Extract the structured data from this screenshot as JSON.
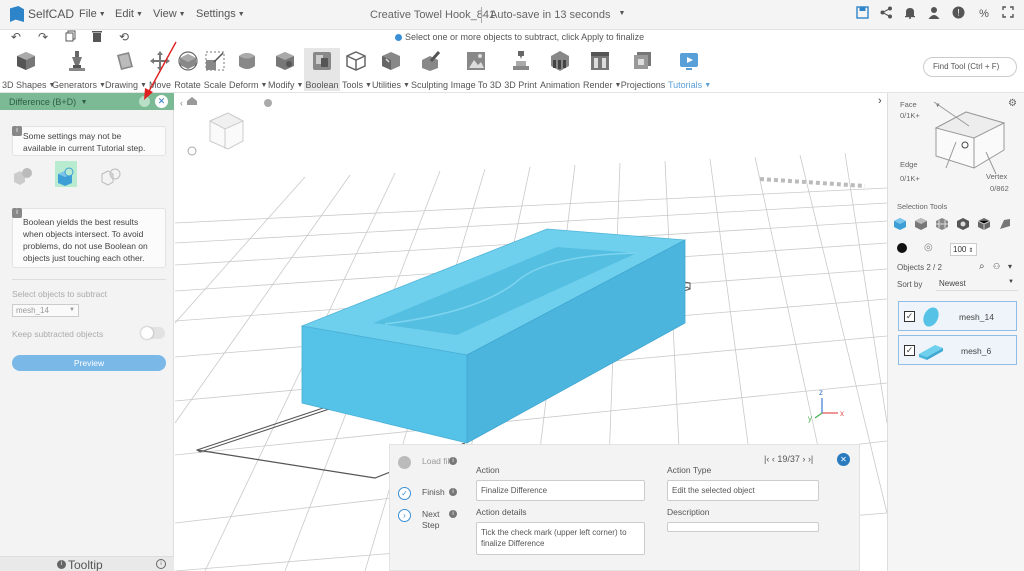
{
  "app": {
    "name": "SelfCAD",
    "project_title": "Creative Towel Hook_841",
    "autosave": "Auto-save in 13 seconds",
    "accent": "#2e84c8"
  },
  "menu": [
    "File",
    "Edit",
    "View",
    "Settings"
  ],
  "hint": "Select one or more objects to subtract, click Apply to finalize",
  "toolbar": {
    "tools": [
      {
        "label": "3D Shapes",
        "icon": "cube-icon"
      },
      {
        "label": "Generators",
        "icon": "generator-icon"
      },
      {
        "label": "Drawing",
        "icon": "drawing-icon"
      },
      {
        "label": "Move",
        "icon": "move-icon"
      },
      {
        "label": "Rotate",
        "icon": "rotate-icon"
      },
      {
        "label": "Scale",
        "icon": "scale-icon"
      },
      {
        "label": "Deform",
        "icon": "deform-icon"
      },
      {
        "label": "Modify",
        "icon": "modify-icon"
      },
      {
        "label": "Boolean",
        "icon": "boolean-icon"
      },
      {
        "label": "Tools",
        "icon": "tools-icon"
      },
      {
        "label": "Utilities",
        "icon": "utilities-icon"
      },
      {
        "label": "Sculpting",
        "icon": "sculpting-icon"
      },
      {
        "label": "Image To 3D",
        "icon": "image-to-3d-icon"
      },
      {
        "label": "3D Print",
        "icon": "3d-print-icon"
      },
      {
        "label": "Animation",
        "icon": "animation-icon"
      },
      {
        "label": "Render",
        "icon": "render-icon"
      },
      {
        "label": "Projections",
        "icon": "projections-icon"
      },
      {
        "label": "Tutorials",
        "icon": "tutorials-icon"
      }
    ],
    "find_tool": "Find Tool (Ctrl + F)"
  },
  "left_panel": {
    "title": "Difference (B+D)",
    "notice": "Some settings may not be available in current Tutorial step.",
    "tip": "Boolean yields the best results when objects intersect. To avoid problems, do not use Boolean on objects just touching each other.",
    "select_label": "Select objects to subtract",
    "select_value": "mesh_14",
    "keep_label": "Keep subtracted objects",
    "preview": "Preview",
    "tooltip": "Tooltip"
  },
  "steps": {
    "items": [
      {
        "label": "Load file",
        "state": "done"
      },
      {
        "label": "Finish",
        "state": "current"
      },
      {
        "label": "Next Step",
        "state": "next"
      }
    ],
    "pager": "19/37",
    "action_label": "Action",
    "action_value": "Finalize Difference",
    "details_label": "Action details",
    "details_value": "Tick the check mark (upper left corner) to finalize Difference",
    "type_label": "Action Type",
    "type_value": "Edit the selected object",
    "description_label": "Description",
    "description_value": ""
  },
  "right_panel": {
    "face_label": "Face",
    "face_count": "0/1K+",
    "edge_label": "Edge",
    "edge_count": "0/1K+",
    "vertex_label": "Vertex",
    "vertex_count": "0/862",
    "selection_tools": "Selection Tools",
    "opacity": "100",
    "objects_label": "Objects 2 / 2",
    "sort_label": "Sort by",
    "sort_value": "Newest",
    "objects": [
      {
        "name": "mesh_14",
        "checked": true
      },
      {
        "name": "mesh_6",
        "checked": true
      }
    ]
  },
  "colors": {
    "model": "#56c3e6",
    "panel_header": "#7cb995",
    "preview_button": "#7ab8e8"
  }
}
